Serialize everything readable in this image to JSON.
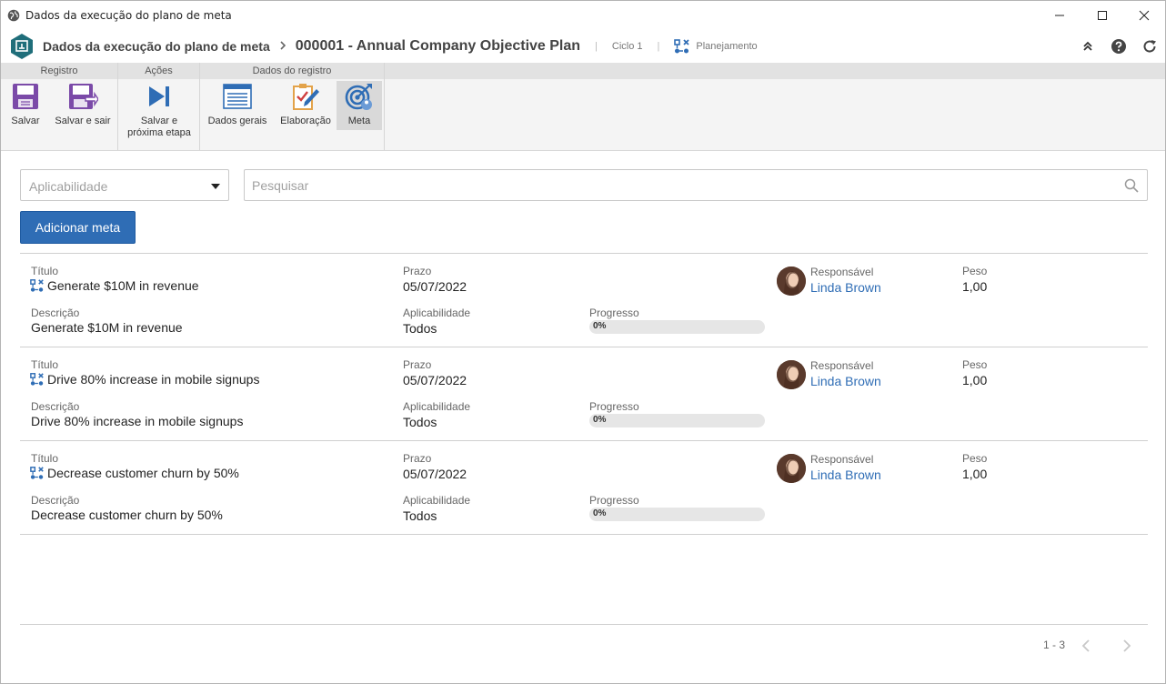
{
  "window": {
    "title": "Dados da execução do plano de meta"
  },
  "header": {
    "breadcrumb_section": "Dados da execução do plano de meta",
    "record_title": "000001 - Annual Company Objective Plan",
    "cycle": "Ciclo 1",
    "status": "Planejamento"
  },
  "ribbon": {
    "groups": {
      "registro": "Registro",
      "acoes": "Ações",
      "dados_registro": "Dados do registro"
    },
    "buttons": {
      "salvar": "Salvar",
      "salvar_sair": "Salvar e sair",
      "salvar_proxima_l1": "Salvar e",
      "salvar_proxima_l2": "próxima etapa",
      "dados_gerais": "Dados gerais",
      "elaboracao": "Elaboração",
      "meta": "Meta"
    }
  },
  "filters": {
    "applicability_placeholder": "Aplicabilidade",
    "search_placeholder": "Pesquisar"
  },
  "actions": {
    "add_goal": "Adicionar meta"
  },
  "labels": {
    "title": "Título",
    "deadline": "Prazo",
    "responsible": "Responsável",
    "weight": "Peso",
    "description": "Descrição",
    "applicability": "Aplicabilidade",
    "progress": "Progresso"
  },
  "goals": [
    {
      "title": "Generate $10M in revenue",
      "deadline": "05/07/2022",
      "responsible": "Linda Brown",
      "weight": "1,00",
      "description": "Generate $10M in revenue",
      "applicability": "Todos",
      "progress_text": "0%",
      "progress": 0
    },
    {
      "title": "Drive 80% increase in mobile signups",
      "deadline": "05/07/2022",
      "responsible": "Linda Brown",
      "weight": "1,00",
      "description": "Drive 80% increase in mobile signups",
      "applicability": "Todos",
      "progress_text": "0%",
      "progress": 0
    },
    {
      "title": "Decrease customer churn by 50%",
      "deadline": "05/07/2022",
      "responsible": "Linda Brown",
      "weight": "1,00",
      "description": "Decrease customer churn by 50%",
      "applicability": "Todos",
      "progress_text": "0%",
      "progress": 0
    }
  ],
  "pagination": {
    "range": "1 - 3"
  },
  "colors": {
    "accent": "#2f6db5",
    "brand": "#1f6e7a",
    "ribbon_purple": "#7b4aa8"
  }
}
